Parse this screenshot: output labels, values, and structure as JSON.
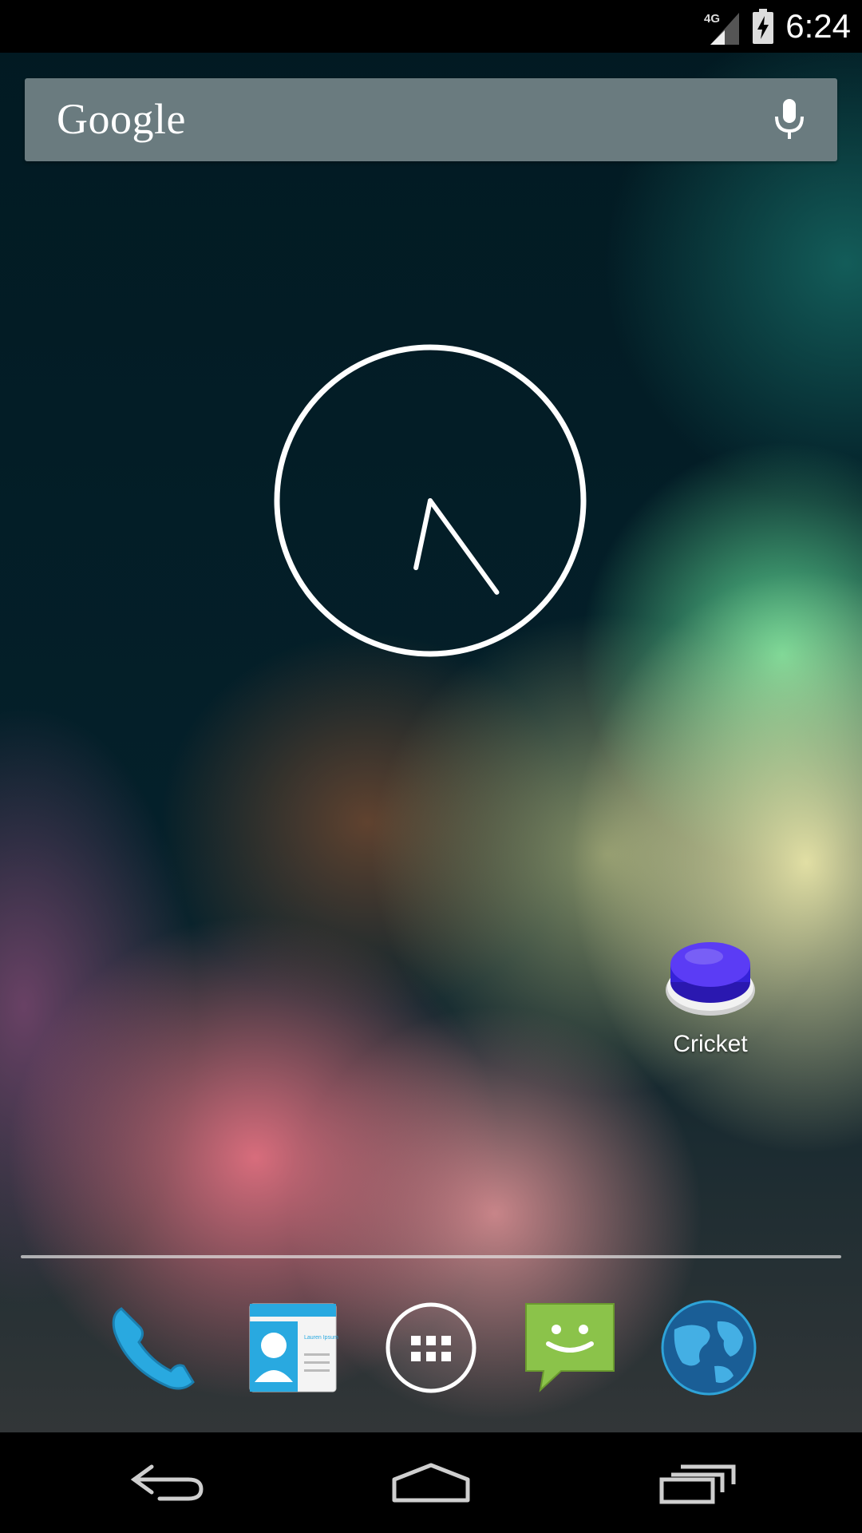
{
  "status_bar": {
    "network_label": "4G",
    "time": "6:24",
    "signal_icon": "cell-signal-icon",
    "battery_icon": "battery-charging-icon"
  },
  "search": {
    "logo_text": "Google",
    "mic_icon": "microphone-icon"
  },
  "widgets": {
    "analog_clock": {
      "hour": 6,
      "minute": 24
    }
  },
  "home_apps": [
    {
      "label": "Cricket",
      "icon": "cricket-button-icon"
    }
  ],
  "dock": [
    {
      "icon": "phone-icon"
    },
    {
      "icon": "contacts-icon",
      "card_text": "Lauren Ipsum"
    },
    {
      "icon": "app-drawer-icon"
    },
    {
      "icon": "messaging-icon"
    },
    {
      "icon": "browser-globe-icon"
    }
  ],
  "nav_bar": [
    {
      "icon": "back-icon"
    },
    {
      "icon": "home-icon"
    },
    {
      "icon": "recent-apps-icon"
    }
  ],
  "colors": {
    "search_bar": "#6a7b7f",
    "cricket_button": "#4a2ff0",
    "messaging": "#8bc34a",
    "phone": "#29a9e0"
  }
}
